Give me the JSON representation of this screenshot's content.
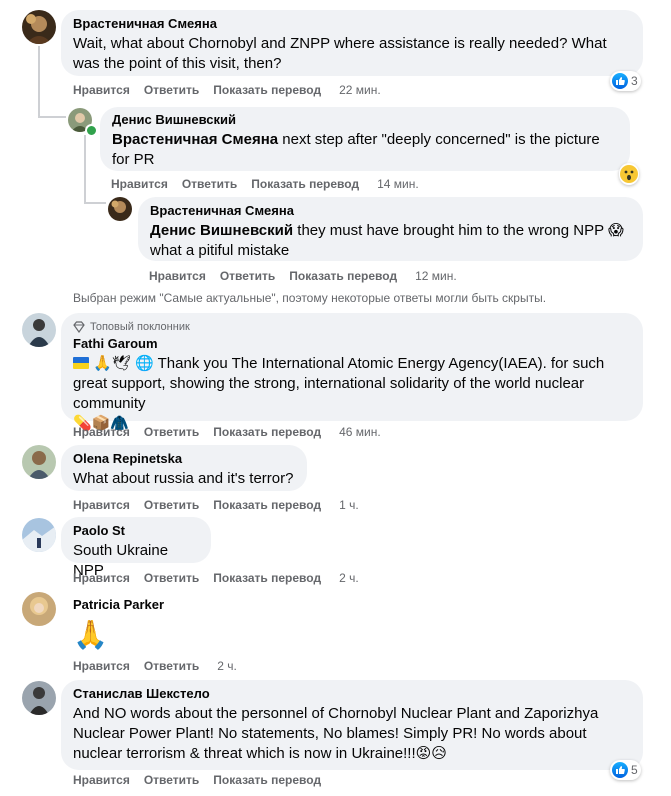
{
  "actions": {
    "like": "Нравится",
    "reply": "Ответить",
    "translate": "Показать перевод"
  },
  "colors": {
    "bubble": "#f0f2f5",
    "meta": "#65676b",
    "like_blue": "#1877f2"
  },
  "sort_note": "Выбран режим \"Самые актуальные\", поэтому некоторые ответы могли быть скрыты.",
  "comments": [
    {
      "name": "Врастеничная Смеяна",
      "text": "Wait, what about Chornobyl and ZNPP where assistance is really needed? What was the point of this visit, then?",
      "time": "22 мин.",
      "reactions": {
        "icon": "like-icon",
        "count": "3"
      }
    },
    {
      "name": "Денис Вишневский",
      "mention": "Врастеничная Смеяна",
      "text": " next step after \"deeply concerned\" is the picture for PR",
      "time": "14 мин.",
      "reactions": {
        "icon": "wow-icon"
      }
    },
    {
      "name": "Врастеничная Смеяна",
      "mention": "Денис Вишневский",
      "text": " they must have brought him to the wrong NPP 😱 what a pitiful mistake",
      "time": "12 мин."
    },
    {
      "badge": "Топовый поклонник",
      "name": "Fathi Garoum",
      "emoji_prefix": "🙏🕊 🌐",
      "text": " Thank you The International Atomic Energy Agency(IAEA). for such great support, showing the strong, international solidarity of the world nuclear community",
      "emoji_suffix": "💊📦🧥",
      "time": "46 мин."
    },
    {
      "name": "Olena Repinetska",
      "text": "What about russia and it's terror?",
      "time": "1 ч."
    },
    {
      "name": "Paolo St",
      "text": "South Ukraine NPP",
      "time": "2 ч."
    },
    {
      "name": "Patricia Parker",
      "text": "🙏",
      "time": "2 ч."
    },
    {
      "name": "Станислав Шекстело",
      "text": "And NO words about the personnel of Chornobyl Nuclear Plant and Zaporizhya Nuclear Power Plant! No statements, No blames! Simply PR! No words about nuclear terrorism & threat which is now in Ukraine!!!😡😥",
      "time": "",
      "reactions": {
        "icon": "like-icon",
        "count": "5"
      }
    }
  ]
}
